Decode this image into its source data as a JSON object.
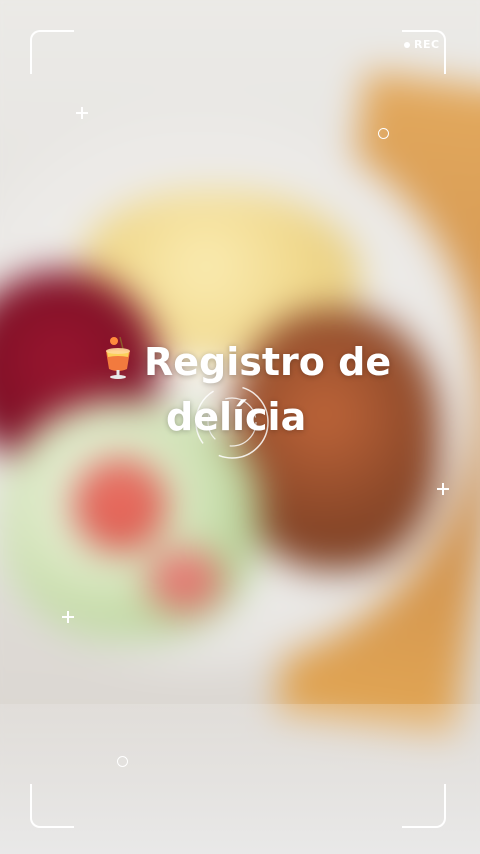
{
  "recording_indicator": {
    "label": "REC"
  },
  "caption": {
    "emoji": "tropical-drink",
    "line1": "Registro de",
    "line2": "delícia"
  },
  "colors": {
    "overlay": "#ffffff"
  }
}
